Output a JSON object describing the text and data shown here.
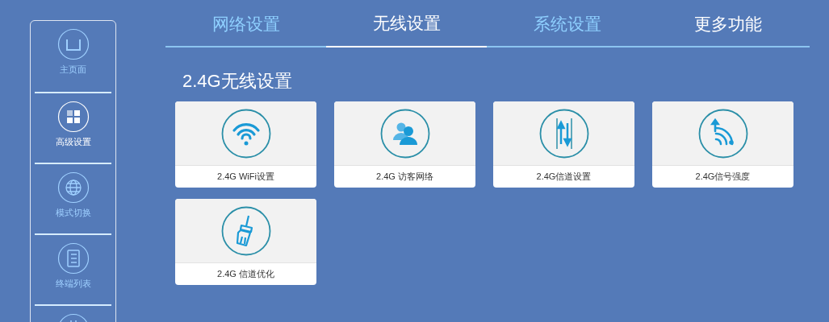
{
  "sidebar": {
    "items": [
      {
        "kind": "router",
        "label": "主页面",
        "selected": false
      },
      {
        "kind": "apps",
        "label": "高级设置",
        "selected": true
      },
      {
        "kind": "globe",
        "label": "模式切换",
        "selected": false
      },
      {
        "kind": "list",
        "label": "终端列表",
        "selected": false
      },
      {
        "kind": "chip",
        "selected": false
      }
    ]
  },
  "tabs": [
    {
      "label": "网络设置",
      "selected": false,
      "highlighted": false
    },
    {
      "label": "无线设置",
      "selected": true,
      "highlighted": true
    },
    {
      "label": "系统设置",
      "selected": false,
      "highlighted": false
    },
    {
      "label": "更多功能",
      "selected": false,
      "highlighted": true
    }
  ],
  "section_title": "2.4G无线设置",
  "cards": [
    {
      "kind": "wifi",
      "label": "2.4G WiFi设置"
    },
    {
      "kind": "guests",
      "label": "2.4G 访客网络"
    },
    {
      "kind": "channel",
      "label": "2.4G信道设置"
    },
    {
      "kind": "signal",
      "label": "2.4G信号强度"
    },
    {
      "kind": "brush",
      "label": "2.4G 信道优化"
    }
  ]
}
